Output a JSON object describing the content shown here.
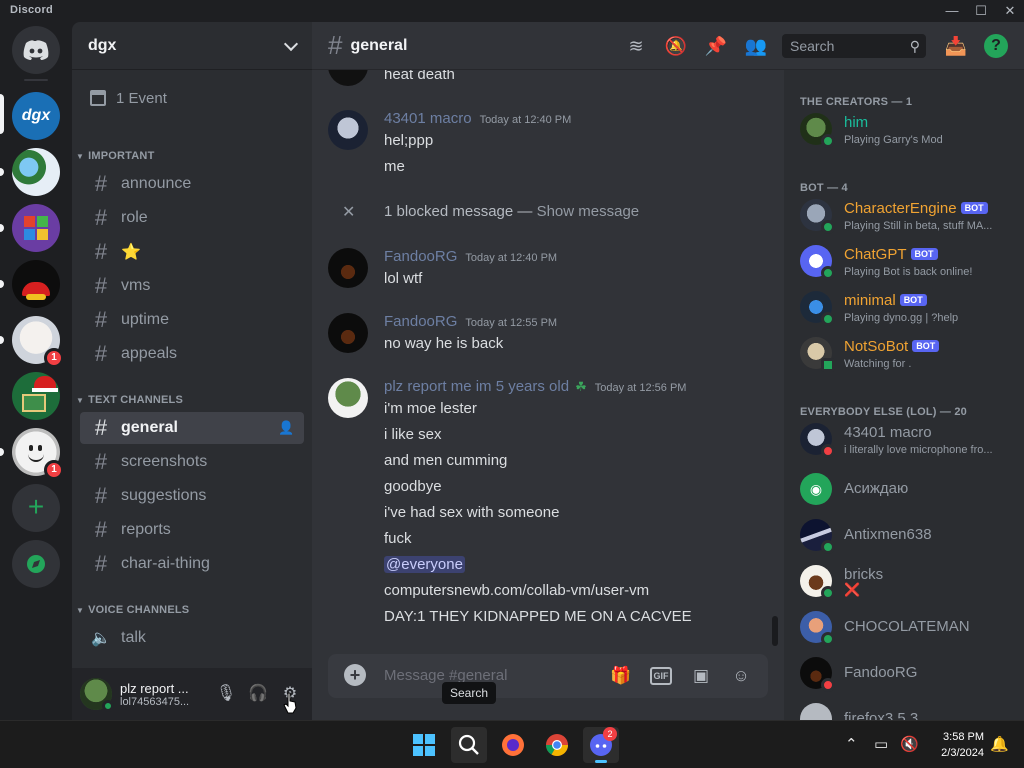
{
  "window": {
    "app_name": "Discord",
    "minimize": "—",
    "maximize": "☐",
    "close": "✕"
  },
  "servers": [
    {
      "name": "Direct Messages"
    },
    {
      "name": "dgx",
      "label": "dgx"
    },
    {
      "name": "server-messenger"
    },
    {
      "name": "server-windows"
    },
    {
      "name": "server-red-cap"
    },
    {
      "name": "server-anime",
      "badge": "1"
    },
    {
      "name": "server-christmas"
    },
    {
      "name": "server-face",
      "badge": "1"
    }
  ],
  "guild": {
    "name": "dgx",
    "event": "1 Event",
    "categories": {
      "important": "IMPORTANT",
      "text": "TEXT CHANNELS",
      "voice": "VOICE CHANNELS"
    },
    "important_channels": [
      "announce",
      "role",
      "⭐",
      "vms",
      "uptime",
      "appeals"
    ],
    "text_channels": [
      "general",
      "screenshots",
      "suggestions",
      "reports",
      "char-ai-thing"
    ],
    "voice_channels": [
      "talk"
    ]
  },
  "user": {
    "name": "plz report ...",
    "tag": "lol74563475..."
  },
  "chat": {
    "channel": "general",
    "search_placeholder": "Search",
    "composer_placeholder": "Message #general",
    "tooltip": "Search",
    "messages": {
      "top_line": "heat death",
      "m1_author": "43401 macro",
      "m1_time": "Today at 12:40 PM",
      "m1_lines": [
        "hel;ppp",
        "me"
      ],
      "blocked": "1 blocked message — ",
      "blocked_show": "Show message",
      "m2_author": "FandooRG",
      "m2_time": "Today at 12:40 PM",
      "m2_line": "lol wtf",
      "m3_author": "FandooRG",
      "m3_time": "Today at 12:55 PM",
      "m3_line": "no way he is back",
      "m4_author": "plz report me im 5 years old",
      "m4_time": "Today at 12:56 PM",
      "m4_lines": [
        "i'm moe lester",
        "i like sex",
        "and men cumming",
        "goodbye",
        "i've had sex with someone",
        "fuck"
      ],
      "m4_mention": "@everyone",
      "m4_tail": [
        "computersnewb.com/collab-vm/user-vm",
        "DAY:1 THEY KIDNAPPED ME ON A CACVEE"
      ]
    }
  },
  "members": {
    "cat_creators": "THE CREATORS — 1",
    "cat_bot": "BOT — 4",
    "cat_else": "EVERYBODY ELSE (LOL) — 20",
    "bot_label": "BOT",
    "creators": [
      {
        "name": "him",
        "sub": "Playing Garry's Mod"
      }
    ],
    "bots": [
      {
        "name": "CharacterEngine",
        "sub": "Playing Still in beta, stuff MA..."
      },
      {
        "name": "ChatGPT",
        "sub": "Playing Bot is back online!"
      },
      {
        "name": "minimal",
        "sub": "Playing dyno.gg | ?help"
      },
      {
        "name": "NotSoBot",
        "sub": "Watching for ."
      }
    ],
    "others": [
      {
        "name": "43401 macro",
        "sub": "i literally love microphone fro..."
      },
      {
        "name": "Асиждаю",
        "sub": ""
      },
      {
        "name": "Antixmen638",
        "sub": ""
      },
      {
        "name": "bricks",
        "sub": "❌"
      },
      {
        "name": "CHOCOLATEMAN",
        "sub": ""
      },
      {
        "name": "FandooRG",
        "sub": ""
      },
      {
        "name": "firefox3.5.3",
        "sub": ""
      }
    ]
  },
  "taskbar": {
    "time": "3:58 PM",
    "date": "2/3/2024",
    "discord_badge": "2"
  },
  "colors": {
    "accent": "#5865f2",
    "online": "#23a55a",
    "dnd": "#f23f43",
    "bot_name": "#f0b232",
    "creator_name": "#1abc9c"
  }
}
